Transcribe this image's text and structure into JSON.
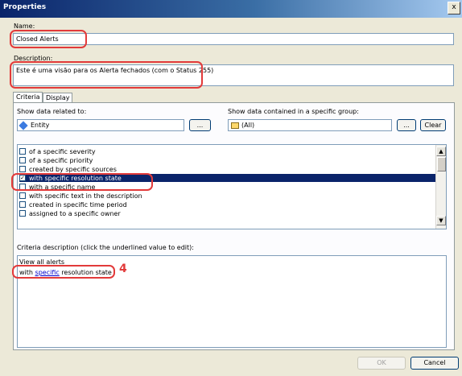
{
  "window": {
    "title": "Properties",
    "close_glyph": "x"
  },
  "name": {
    "label": "Name:",
    "value": "Closed Alerts"
  },
  "description": {
    "label": "Description:",
    "value": "Este é uma visão para os Alerta fechados (com o Status 255)"
  },
  "tabs": [
    {
      "label": "Criteria",
      "active": true
    },
    {
      "label": "Display",
      "active": false
    }
  ],
  "criteria": {
    "show_related_label": "Show data related to:",
    "entity_value": "Entity",
    "browse1": "...",
    "group_label": "Show data contained in a specific group:",
    "group_value": "(All)",
    "browse2": "...",
    "clear": "Clear",
    "list": [
      {
        "label": "of a specific severity",
        "checked": false,
        "selected": false
      },
      {
        "label": "of a specific priority",
        "checked": false,
        "selected": false
      },
      {
        "label": "created by specific sources",
        "checked": false,
        "selected": false
      },
      {
        "label": "with specific resolution state",
        "checked": true,
        "selected": true
      },
      {
        "label": "with a specific name",
        "checked": false,
        "selected": false
      },
      {
        "label": "with specific text in the description",
        "checked": false,
        "selected": false
      },
      {
        "label": "created in specific time period",
        "checked": false,
        "selected": false
      },
      {
        "label": "assigned to a specific owner",
        "checked": false,
        "selected": false
      }
    ],
    "desc_label": "Criteria description (click the underlined value to edit):",
    "desc_line1": "View all alerts",
    "desc_line2_prefix": "with",
    "desc_line2_link": "specific",
    "desc_line2_suffix": "resolution state",
    "annotation": "4"
  },
  "buttons": {
    "ok": "OK",
    "cancel": "Cancel"
  },
  "colors": {
    "highlight": "#0a246a",
    "annotation_red": "#e23a3a"
  }
}
